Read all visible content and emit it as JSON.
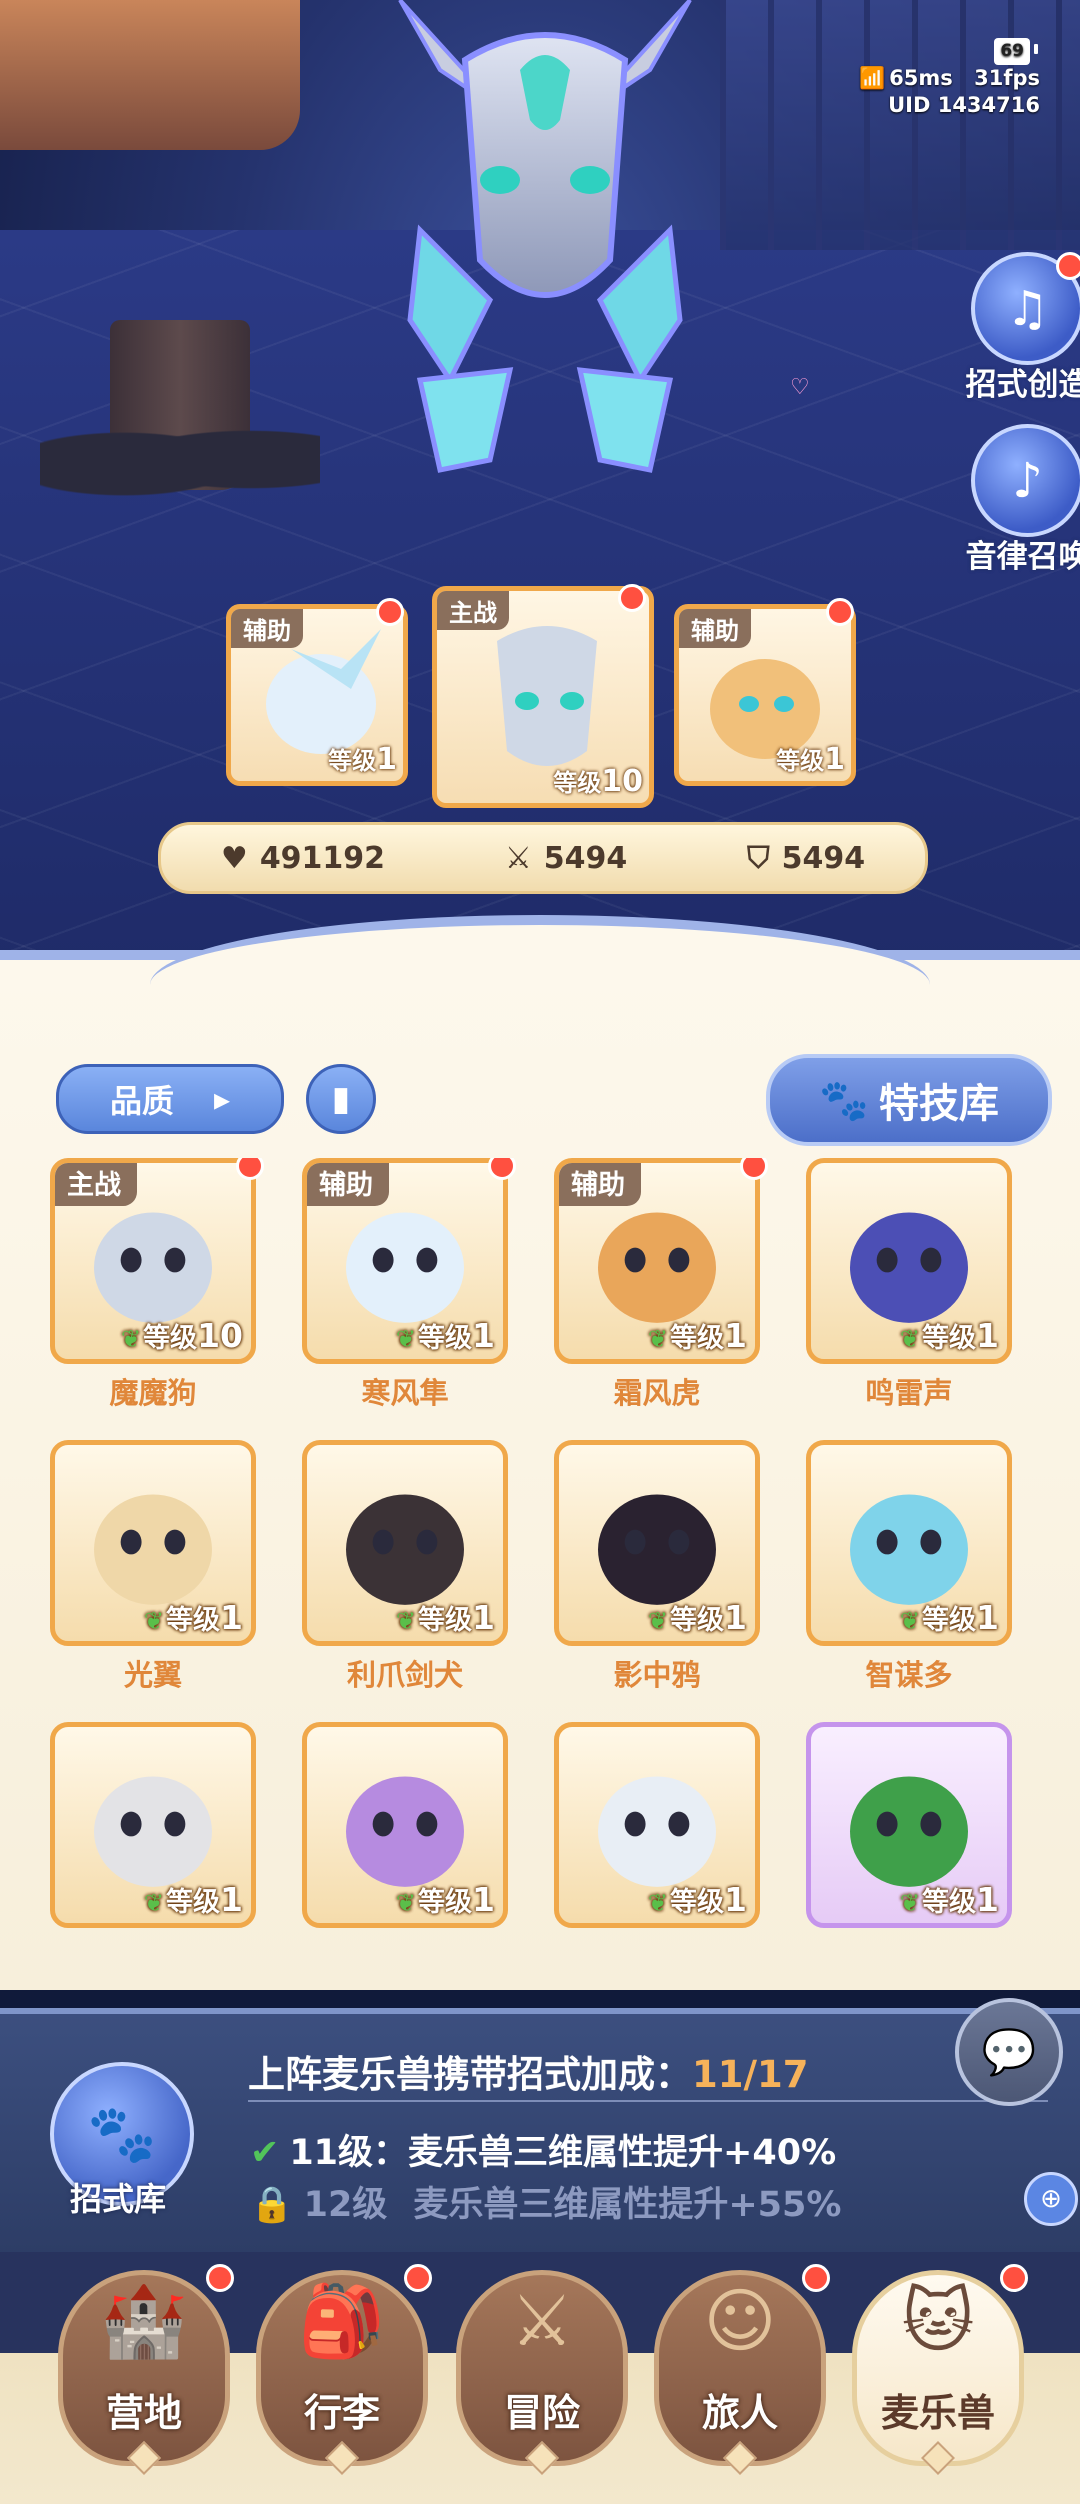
{
  "hud": {
    "battery": "69",
    "ping": "65ms",
    "fps": "31fps",
    "uid": "UID 1434716"
  },
  "side_buttons": [
    {
      "label": "招式创造",
      "has_badge": true
    },
    {
      "label": "音律召唤",
      "has_badge": false
    }
  ],
  "team": [
    {
      "role": "辅助",
      "level_prefix": "等级",
      "level": "1",
      "has_badge": true
    },
    {
      "role": "主战",
      "level_prefix": "等级",
      "level": "10",
      "has_badge": true
    },
    {
      "role": "辅助",
      "level_prefix": "等级",
      "level": "1",
      "has_badge": true
    }
  ],
  "stats": {
    "hp": "491192",
    "attack": "5494",
    "defense": "5494"
  },
  "toolbar": {
    "filter_label": "品质",
    "skill_library_label": "特技库"
  },
  "pets": [
    {
      "name": "魔魔狗",
      "role": "主战",
      "level_prefix": "等级",
      "level": "10",
      "has_badge": true,
      "frame": "orange",
      "color": "#cfd8e6"
    },
    {
      "name": "寒风隼",
      "role": "辅助",
      "level_prefix": "等级",
      "level": "1",
      "has_badge": true,
      "frame": "orange",
      "color": "#e3f0fb"
    },
    {
      "name": "霜风虎",
      "role": "辅助",
      "level_prefix": "等级",
      "level": "1",
      "has_badge": true,
      "frame": "orange",
      "color": "#e9a65a"
    },
    {
      "name": "鸣雷声",
      "role": "",
      "level_prefix": "等级",
      "level": "1",
      "has_badge": false,
      "frame": "orange",
      "color": "#4c4fb5"
    },
    {
      "name": "光翼",
      "role": "",
      "level_prefix": "等级",
      "level": "1",
      "has_badge": false,
      "frame": "orange",
      "color": "#efd7a8"
    },
    {
      "name": "利爪剑犬",
      "role": "",
      "level_prefix": "等级",
      "level": "1",
      "has_badge": false,
      "frame": "orange",
      "color": "#3b3236"
    },
    {
      "name": "影中鸦",
      "role": "",
      "level_prefix": "等级",
      "level": "1",
      "has_badge": false,
      "frame": "orange",
      "color": "#2a2230"
    },
    {
      "name": "智谋多",
      "role": "",
      "level_prefix": "等级",
      "level": "1",
      "has_badge": false,
      "frame": "orange",
      "color": "#7fd3ea"
    },
    {
      "name": "",
      "role": "",
      "level_prefix": "等级",
      "level": "1",
      "has_badge": false,
      "frame": "orange",
      "color": "#e3e3e6"
    },
    {
      "name": "",
      "role": "",
      "level_prefix": "等级",
      "level": "1",
      "has_badge": false,
      "frame": "orange",
      "color": "#b68be0"
    },
    {
      "name": "",
      "role": "",
      "level_prefix": "等级",
      "level": "1",
      "has_badge": false,
      "frame": "orange",
      "color": "#e8eef5"
    },
    {
      "name": "",
      "role": "",
      "level_prefix": "等级",
      "level": "1",
      "has_badge": false,
      "frame": "purple",
      "color": "#3fa04a"
    }
  ],
  "bonus": {
    "library_label": "招式库",
    "title": "上阵麦乐兽携带招式加成：",
    "progress": "11/17",
    "tiers": [
      {
        "level": "11级：",
        "text": "麦乐兽三维属性提升+40%",
        "unlocked": true
      },
      {
        "level": "12级",
        "text": "麦乐兽三维属性提升+55%",
        "unlocked": false
      }
    ]
  },
  "nav": [
    {
      "label": "营地",
      "icon": "castle-icon",
      "has_badge": true,
      "active": false
    },
    {
      "label": "行李",
      "icon": "backpack-icon",
      "has_badge": true,
      "active": false
    },
    {
      "label": "冒险",
      "icon": "crossed-swords-icon",
      "has_badge": false,
      "active": false
    },
    {
      "label": "旅人",
      "icon": "traveler-icon",
      "has_badge": true,
      "active": false
    },
    {
      "label": "麦乐兽",
      "icon": "pet-icon",
      "has_badge": true,
      "active": true
    }
  ],
  "colors": {
    "accent_orange": "#e0873a",
    "frame_orange": "#f0a84a",
    "panel_blue": "#5a86dc",
    "badge_red": "#ff5040"
  }
}
